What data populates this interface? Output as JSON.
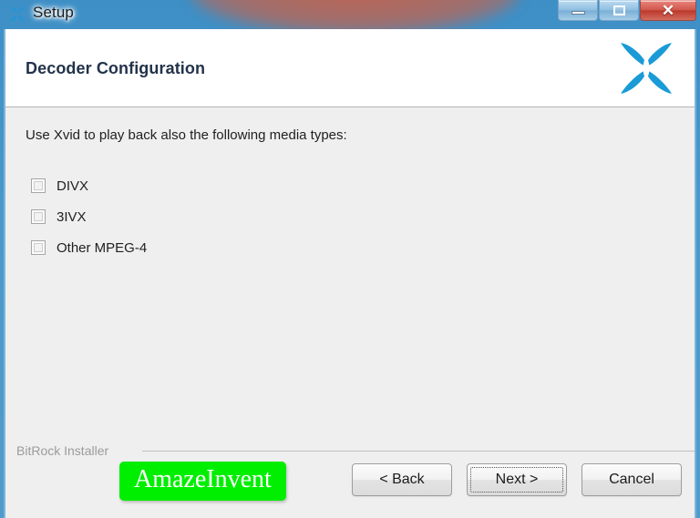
{
  "window": {
    "title": "Setup",
    "app_icon": "xvid-butterfly-icon",
    "controls": {
      "minimize": "minimize-icon",
      "maximize": "maximize-icon",
      "close": "✕"
    }
  },
  "header": {
    "title": "Decoder Configuration",
    "logo": "xvid-butterfly-logo",
    "accent_color": "#1a9bd7"
  },
  "body": {
    "intro": "Use Xvid to play back also the following media types:",
    "checkboxes": [
      {
        "label": "DIVX",
        "checked": false
      },
      {
        "label": "3IVX",
        "checked": false
      },
      {
        "label": "Other MPEG-4",
        "checked": false
      }
    ]
  },
  "footer": {
    "brand": "BitRock Installer",
    "watermark": "AmazeInvent",
    "watermark_color": "#00ee00",
    "buttons": [
      {
        "label": "< Back",
        "focused": false
      },
      {
        "label": "Next >",
        "focused": true
      },
      {
        "label": "Cancel",
        "focused": false
      }
    ]
  }
}
